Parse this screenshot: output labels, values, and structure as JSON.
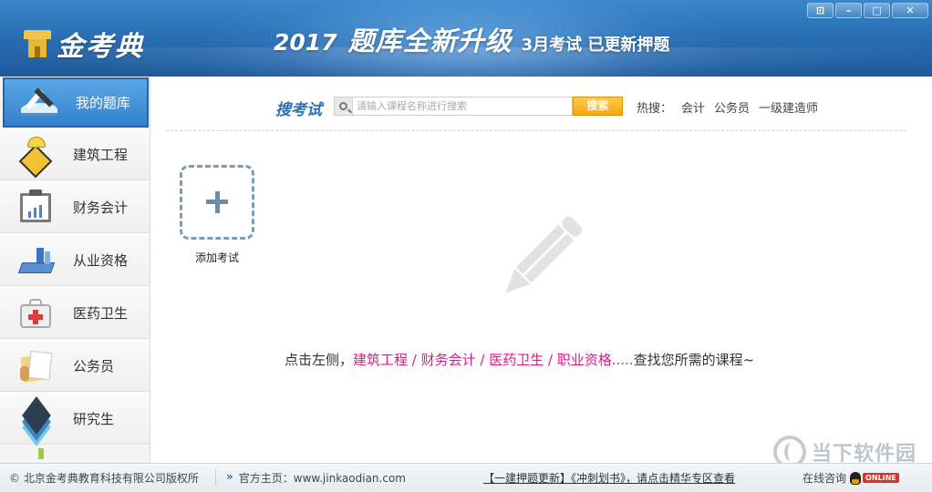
{
  "header": {
    "logo_text": "金考典",
    "banner_year": "2017",
    "banner_slogan": "题库全新升级",
    "banner_sub": "3月考试 已更新押题",
    "window_buttons": [
      "⊡",
      "–",
      "□",
      "✕"
    ]
  },
  "sidebar": {
    "items": [
      {
        "label": "我的题库",
        "icon": "book-pen-icon",
        "active": true
      },
      {
        "label": "建筑工程",
        "icon": "construction-sign-icon",
        "active": false
      },
      {
        "label": "财务会计",
        "icon": "clipboard-chart-icon",
        "active": false
      },
      {
        "label": "从业资格",
        "icon": "books-stack-icon",
        "active": false
      },
      {
        "label": "医药卫生",
        "icon": "medical-kit-icon",
        "active": false
      },
      {
        "label": "公务员",
        "icon": "folder-documents-icon",
        "active": false
      },
      {
        "label": "研究生",
        "icon": "layers-icon",
        "active": false
      }
    ]
  },
  "search": {
    "label": "搜考试",
    "placeholder": "请输入课程名称进行搜索",
    "value": "",
    "button_label": "搜索",
    "hot_label": "热搜：",
    "hot_items": [
      "会计",
      "公务员",
      "一级建造师"
    ]
  },
  "main": {
    "add_exam_label": "添加考试",
    "hint_prefix": "点击左侧，",
    "hint_links": "建筑工程 / 财务会计 / 医药卫生 / 职业资格.....",
    "hint_suffix": "查找您所需的课程~"
  },
  "statusbar": {
    "copyright": "© 北京金考典教育科技有限公司版权所",
    "home_label": "官方主页：www.jinkaodian.com",
    "promo": "【一建押题更新】《冲刺划书》，请点击精华专区查看",
    "online_label": "在线咨询",
    "online_badge": "ONLINE"
  },
  "watermark": {
    "text": "当下软件园"
  },
  "colors": {
    "header_blue": "#2a6fb3",
    "accent_blue": "#2d6fb5",
    "search_button": "#f3a90e",
    "highlight_pink": "#e0198a"
  }
}
